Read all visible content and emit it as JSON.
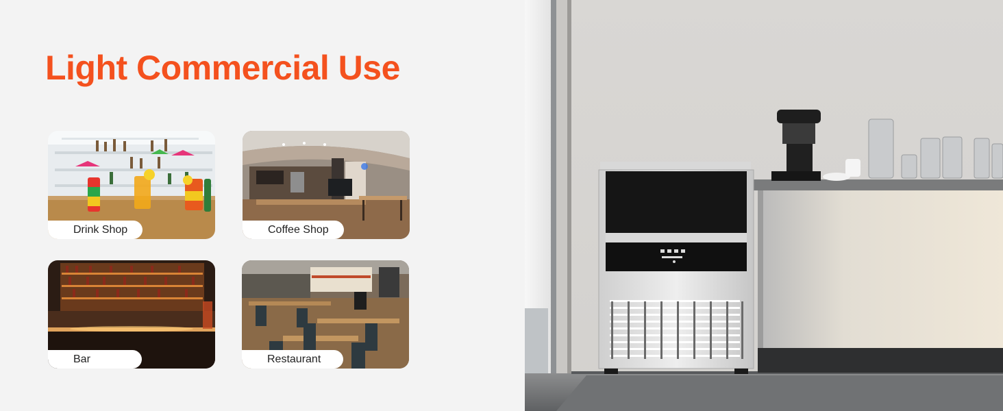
{
  "headline": "Light Commercial Use",
  "accent_color": "#f4511e",
  "use_cases": [
    {
      "label": "Drink Shop",
      "image": "drink-shop-photo"
    },
    {
      "label": "Coffee Shop",
      "image": "coffee-shop-photo"
    },
    {
      "label": "Bar",
      "image": "bar-photo"
    },
    {
      "label": "Restaurant",
      "image": "restaurant-photo"
    }
  ],
  "product_image": "ice-maker-product-photo"
}
